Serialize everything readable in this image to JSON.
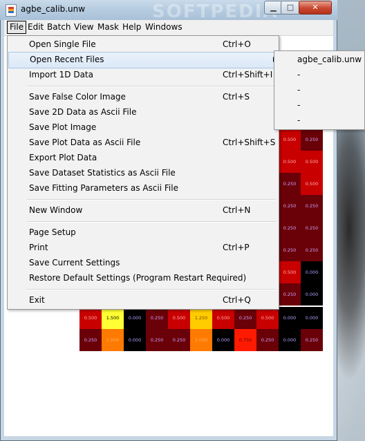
{
  "window": {
    "title": "agbe_calib.unw"
  },
  "watermark": "SOFTPEDIA",
  "menubar": [
    "File",
    "Edit",
    "Batch",
    "View",
    "Mask",
    "Help",
    "Windows"
  ],
  "file_menu": {
    "items": [
      {
        "label": "Open Single File",
        "shortcut": "Ctrl+O"
      },
      {
        "label": "Open Recent Files",
        "shortcut": ""
      },
      {
        "label": "Import 1D Data",
        "shortcut": "Ctrl+Shift+I"
      },
      {
        "label": "Save False Color Image",
        "shortcut": "Ctrl+S"
      },
      {
        "label": "Save 2D Data as Ascii File",
        "shortcut": ""
      },
      {
        "label": "Save Plot Image",
        "shortcut": ""
      },
      {
        "label": "Save Plot Data as Ascii File",
        "shortcut": "Ctrl+Shift+S"
      },
      {
        "label": "Export Plot Data",
        "shortcut": ""
      },
      {
        "label": "Save Dataset Statistics as Ascii File",
        "shortcut": ""
      },
      {
        "label": "Save Fitting Parameters as Ascii File",
        "shortcut": ""
      },
      {
        "label": "New Window",
        "shortcut": "Ctrl+N"
      },
      {
        "label": "Page Setup",
        "shortcut": ""
      },
      {
        "label": "Print",
        "shortcut": "Ctrl+P"
      },
      {
        "label": "Save Current Settings",
        "shortcut": ""
      },
      {
        "label": "Restore Default Settings (Program Restart Required)",
        "shortcut": ""
      },
      {
        "label": "Exit",
        "shortcut": "Ctrl+Q"
      }
    ]
  },
  "recent_files": [
    "agbe_calib.unw",
    "-",
    "-",
    "-",
    "-"
  ],
  "grid": {
    "right_column_rows": [
      [
        "0.500",
        "0.250"
      ],
      [
        "0.500",
        "0.500"
      ],
      [
        "0.250",
        "0.500"
      ],
      [
        "0.250",
        "0.250"
      ],
      [
        "0.250",
        "0.250"
      ],
      [
        "0.250",
        "0.250"
      ],
      [
        "0.500",
        "0.000"
      ],
      [
        "0.250",
        "0.000"
      ]
    ],
    "bottom_rows": [
      [
        "0.500",
        "1.500",
        "0.000",
        "0.250",
        "0.500",
        "1.250",
        "0.500",
        "0.250",
        "0.500",
        "0.000",
        "0.000"
      ],
      [
        "0.250",
        "1.000",
        "0.000",
        "0.250",
        "0.250",
        "1.000",
        "0.000",
        "0.750",
        "0.250",
        "0.000",
        "0.250"
      ]
    ]
  }
}
